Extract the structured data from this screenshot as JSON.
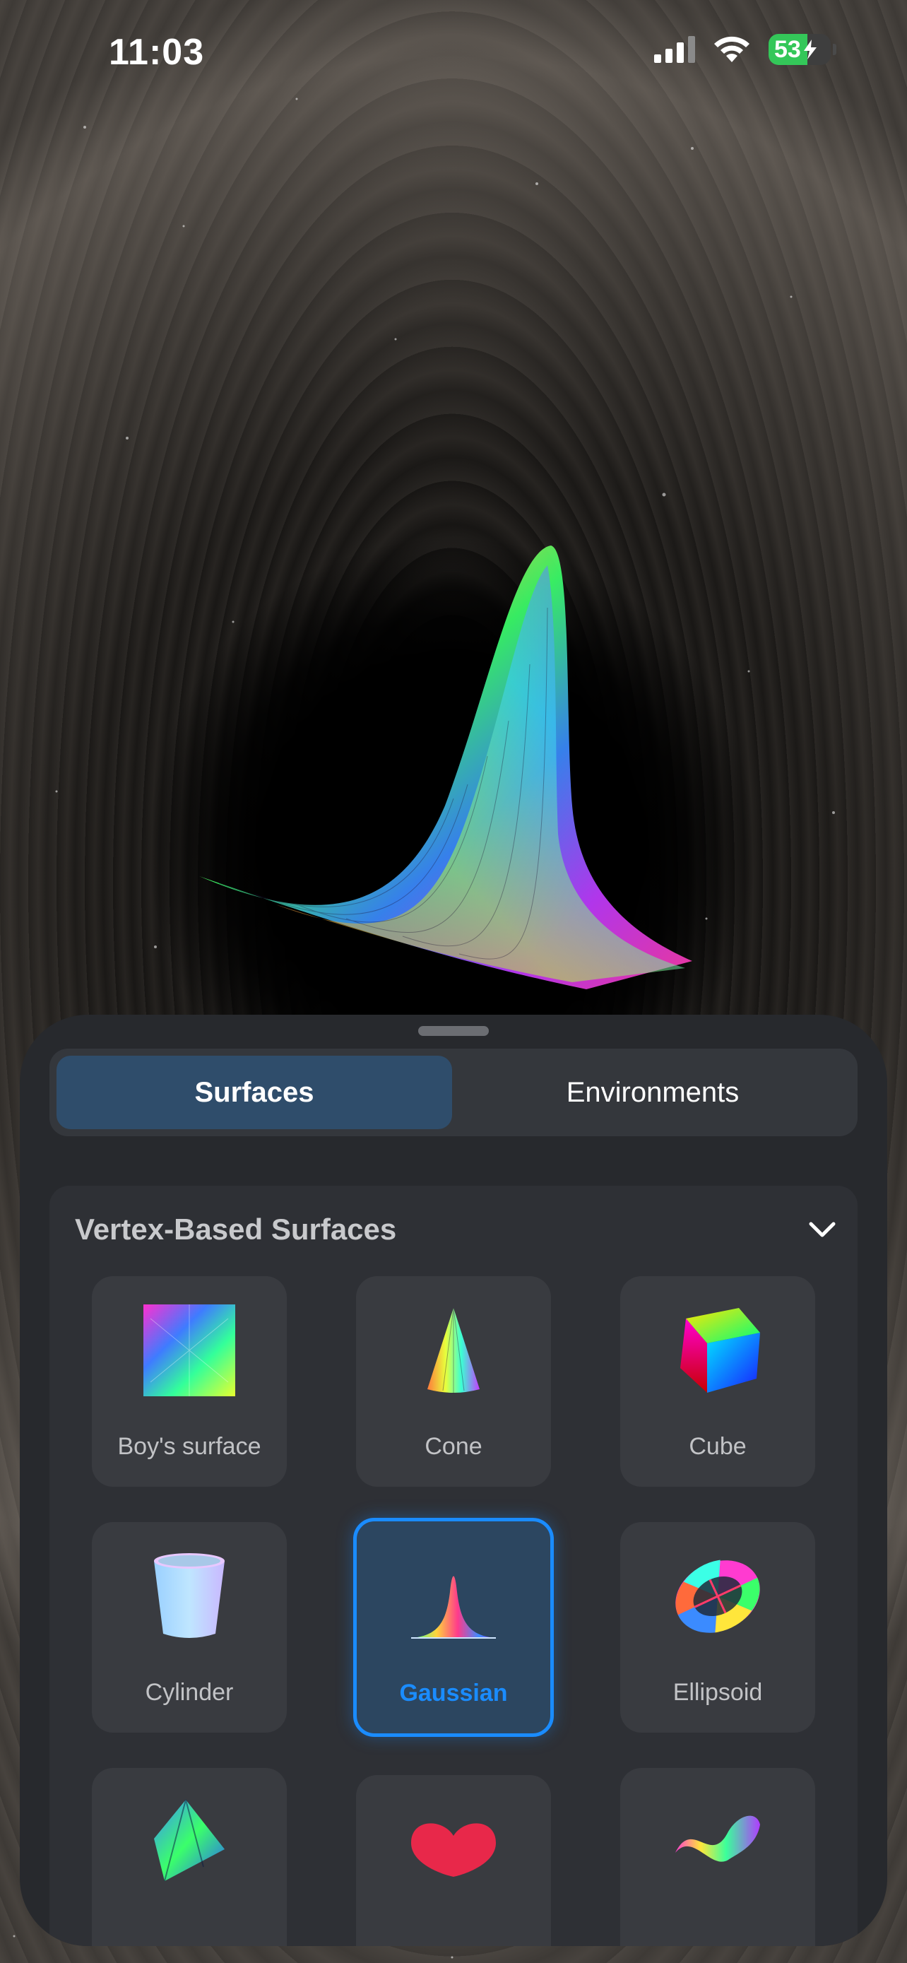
{
  "status": {
    "time": "11:03",
    "battery": "53"
  },
  "tabs": [
    {
      "label": "Surfaces",
      "active": true
    },
    {
      "label": "Environments",
      "active": false
    }
  ],
  "section": {
    "title": "Vertex-Based Surfaces",
    "items": [
      {
        "label": "Boy's surface"
      },
      {
        "label": "Cone"
      },
      {
        "label": "Cube"
      },
      {
        "label": "Cylinder"
      },
      {
        "label": "Gaussian",
        "selected": true
      },
      {
        "label": "Ellipsoid"
      }
    ]
  },
  "colors": {
    "accent": "#1a8cff",
    "panel": "#27292d",
    "battery": "#34c759"
  }
}
